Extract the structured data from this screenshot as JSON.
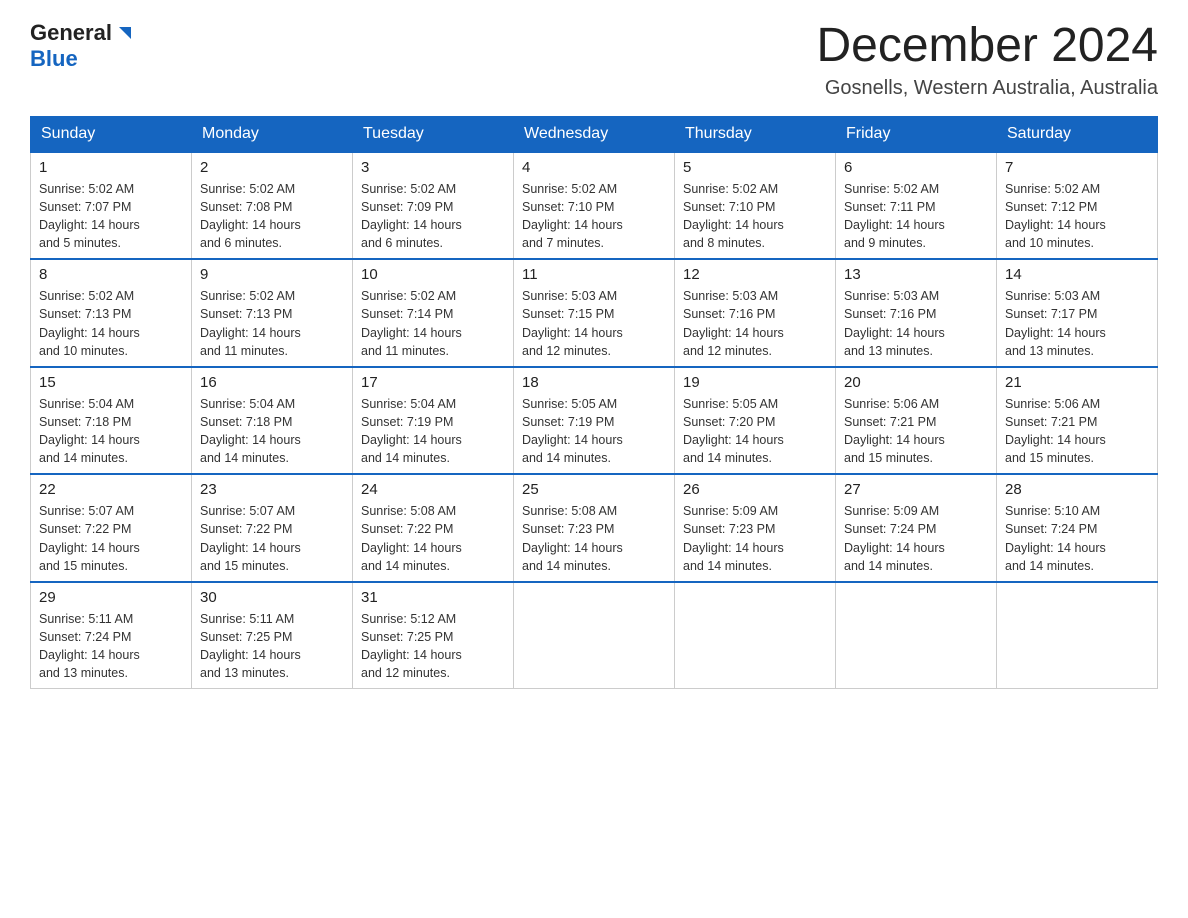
{
  "header": {
    "logo_general": "General",
    "logo_blue": "Blue",
    "title": "December 2024",
    "subtitle": "Gosnells, Western Australia, Australia"
  },
  "days_of_week": [
    "Sunday",
    "Monday",
    "Tuesday",
    "Wednesday",
    "Thursday",
    "Friday",
    "Saturday"
  ],
  "weeks": [
    [
      {
        "day": "1",
        "sunrise": "5:02 AM",
        "sunset": "7:07 PM",
        "daylight": "14 hours and 5 minutes."
      },
      {
        "day": "2",
        "sunrise": "5:02 AM",
        "sunset": "7:08 PM",
        "daylight": "14 hours and 6 minutes."
      },
      {
        "day": "3",
        "sunrise": "5:02 AM",
        "sunset": "7:09 PM",
        "daylight": "14 hours and 6 minutes."
      },
      {
        "day": "4",
        "sunrise": "5:02 AM",
        "sunset": "7:10 PM",
        "daylight": "14 hours and 7 minutes."
      },
      {
        "day": "5",
        "sunrise": "5:02 AM",
        "sunset": "7:10 PM",
        "daylight": "14 hours and 8 minutes."
      },
      {
        "day": "6",
        "sunrise": "5:02 AM",
        "sunset": "7:11 PM",
        "daylight": "14 hours and 9 minutes."
      },
      {
        "day": "7",
        "sunrise": "5:02 AM",
        "sunset": "7:12 PM",
        "daylight": "14 hours and 10 minutes."
      }
    ],
    [
      {
        "day": "8",
        "sunrise": "5:02 AM",
        "sunset": "7:13 PM",
        "daylight": "14 hours and 10 minutes."
      },
      {
        "day": "9",
        "sunrise": "5:02 AM",
        "sunset": "7:13 PM",
        "daylight": "14 hours and 11 minutes."
      },
      {
        "day": "10",
        "sunrise": "5:02 AM",
        "sunset": "7:14 PM",
        "daylight": "14 hours and 11 minutes."
      },
      {
        "day": "11",
        "sunrise": "5:03 AM",
        "sunset": "7:15 PM",
        "daylight": "14 hours and 12 minutes."
      },
      {
        "day": "12",
        "sunrise": "5:03 AM",
        "sunset": "7:16 PM",
        "daylight": "14 hours and 12 minutes."
      },
      {
        "day": "13",
        "sunrise": "5:03 AM",
        "sunset": "7:16 PM",
        "daylight": "14 hours and 13 minutes."
      },
      {
        "day": "14",
        "sunrise": "5:03 AM",
        "sunset": "7:17 PM",
        "daylight": "14 hours and 13 minutes."
      }
    ],
    [
      {
        "day": "15",
        "sunrise": "5:04 AM",
        "sunset": "7:18 PM",
        "daylight": "14 hours and 14 minutes."
      },
      {
        "day": "16",
        "sunrise": "5:04 AM",
        "sunset": "7:18 PM",
        "daylight": "14 hours and 14 minutes."
      },
      {
        "day": "17",
        "sunrise": "5:04 AM",
        "sunset": "7:19 PM",
        "daylight": "14 hours and 14 minutes."
      },
      {
        "day": "18",
        "sunrise": "5:05 AM",
        "sunset": "7:19 PM",
        "daylight": "14 hours and 14 minutes."
      },
      {
        "day": "19",
        "sunrise": "5:05 AM",
        "sunset": "7:20 PM",
        "daylight": "14 hours and 14 minutes."
      },
      {
        "day": "20",
        "sunrise": "5:06 AM",
        "sunset": "7:21 PM",
        "daylight": "14 hours and 15 minutes."
      },
      {
        "day": "21",
        "sunrise": "5:06 AM",
        "sunset": "7:21 PM",
        "daylight": "14 hours and 15 minutes."
      }
    ],
    [
      {
        "day": "22",
        "sunrise": "5:07 AM",
        "sunset": "7:22 PM",
        "daylight": "14 hours and 15 minutes."
      },
      {
        "day": "23",
        "sunrise": "5:07 AM",
        "sunset": "7:22 PM",
        "daylight": "14 hours and 15 minutes."
      },
      {
        "day": "24",
        "sunrise": "5:08 AM",
        "sunset": "7:22 PM",
        "daylight": "14 hours and 14 minutes."
      },
      {
        "day": "25",
        "sunrise": "5:08 AM",
        "sunset": "7:23 PM",
        "daylight": "14 hours and 14 minutes."
      },
      {
        "day": "26",
        "sunrise": "5:09 AM",
        "sunset": "7:23 PM",
        "daylight": "14 hours and 14 minutes."
      },
      {
        "day": "27",
        "sunrise": "5:09 AM",
        "sunset": "7:24 PM",
        "daylight": "14 hours and 14 minutes."
      },
      {
        "day": "28",
        "sunrise": "5:10 AM",
        "sunset": "7:24 PM",
        "daylight": "14 hours and 14 minutes."
      }
    ],
    [
      {
        "day": "29",
        "sunrise": "5:11 AM",
        "sunset": "7:24 PM",
        "daylight": "14 hours and 13 minutes."
      },
      {
        "day": "30",
        "sunrise": "5:11 AM",
        "sunset": "7:25 PM",
        "daylight": "14 hours and 13 minutes."
      },
      {
        "day": "31",
        "sunrise": "5:12 AM",
        "sunset": "7:25 PM",
        "daylight": "14 hours and 12 minutes."
      },
      null,
      null,
      null,
      null
    ]
  ],
  "labels": {
    "sunrise": "Sunrise:",
    "sunset": "Sunset:",
    "daylight": "Daylight:"
  }
}
